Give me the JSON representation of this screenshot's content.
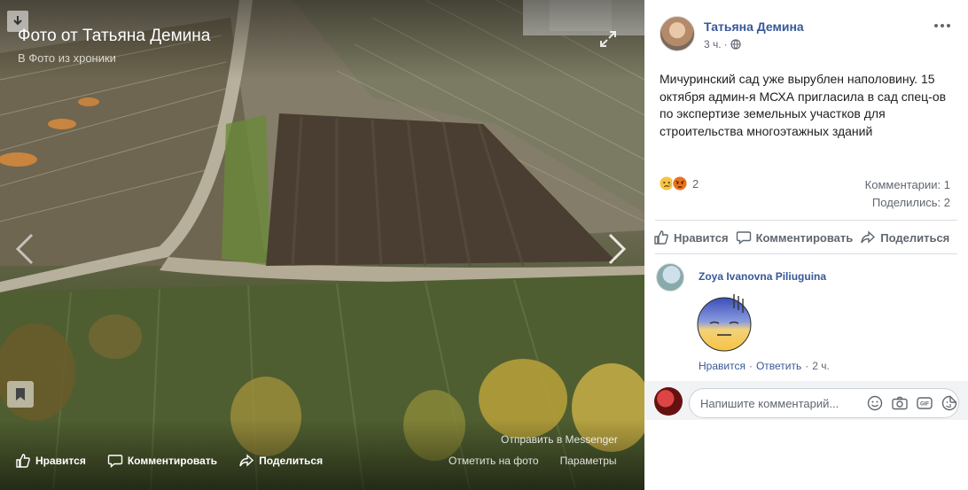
{
  "photo": {
    "title": "Фото от Татьяна Демина",
    "subtitle": "В Фото из хроники",
    "messenger_link": "Отправить в Messenger",
    "actions": {
      "like": "Нравится",
      "comment": "Комментировать",
      "share": "Поделиться"
    },
    "tag_link": "Отметить на фото",
    "options_link": "Параметры"
  },
  "post": {
    "author": "Татьяна Демина",
    "time": "3 ч.",
    "text": "Мичуринский сад уже вырублен наполовину. 15 октября админ-я МСХА пригласила в сад спец-ов по экспертизе земельных участков для строительства многоэтажных зданий",
    "reactions": {
      "icons": [
        "sad-icon",
        "angry-icon"
      ],
      "count": "2"
    },
    "comments_count": "Комментарии: 1",
    "shares_count": "Поделились: 2",
    "actions": {
      "like": "Нравится",
      "comment": "Комментировать",
      "share": "Поделиться"
    }
  },
  "comment": {
    "author": "Zoya Ivanovna Piliuguina",
    "like_link": "Нравится",
    "sep": "·",
    "reply_link": "Ответить",
    "time": "2 ч."
  },
  "composer": {
    "placeholder": "Напишите комментарий..."
  },
  "colors": {
    "link": "#385898",
    "muted": "#606770",
    "text": "#1c1e21",
    "divider": "#dadde1"
  }
}
